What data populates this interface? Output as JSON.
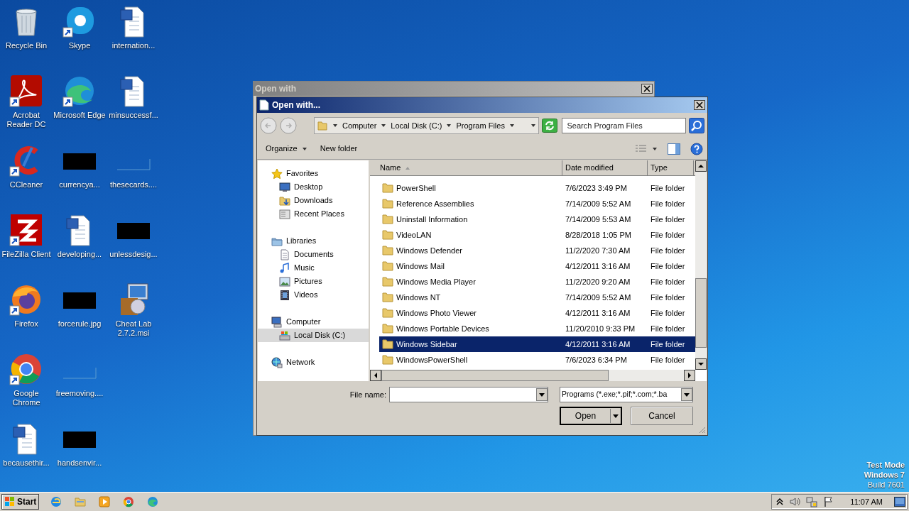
{
  "desktop": {
    "icons": [
      {
        "label": "Recycle Bin",
        "kind": "recycle",
        "shortcut": false
      },
      {
        "label": "Acrobat Reader DC",
        "kind": "acrobat",
        "shortcut": true
      },
      {
        "label": "CCleaner",
        "kind": "ccleaner",
        "shortcut": true
      },
      {
        "label": "FileZilla Client",
        "kind": "filezilla",
        "shortcut": true
      },
      {
        "label": "Firefox",
        "kind": "firefox",
        "shortcut": true
      },
      {
        "label": "Google Chrome",
        "kind": "chrome",
        "shortcut": true
      },
      {
        "label": "becausethir...",
        "kind": "word",
        "shortcut": false
      },
      {
        "label": "Skype",
        "kind": "skype",
        "shortcut": true
      },
      {
        "label": "Microsoft Edge",
        "kind": "edge",
        "shortcut": true
      },
      {
        "label": "currencya...",
        "kind": "redacted",
        "shortcut": false
      },
      {
        "label": "developing...",
        "kind": "word",
        "shortcut": false
      },
      {
        "label": "forcerule.jpg",
        "kind": "redacted",
        "shortcut": false
      },
      {
        "label": "freemoving....",
        "kind": "blank",
        "shortcut": false
      },
      {
        "label": "handsenvir...",
        "kind": "redacted",
        "shortcut": false
      },
      {
        "label": "internation...",
        "kind": "word",
        "shortcut": false
      },
      {
        "label": "minsuccessf...",
        "kind": "word",
        "shortcut": false
      },
      {
        "label": "thesecards....",
        "kind": "blank",
        "shortcut": false
      },
      {
        "label": "unlessdesig...",
        "kind": "redacted",
        "shortcut": false
      },
      {
        "label": "Cheat Lab 2.7.2.msi",
        "kind": "installer",
        "shortcut": false
      }
    ],
    "system_text": [
      {
        "text": "Test Mode",
        "kind": "heading"
      },
      {
        "text": "Windows 7",
        "kind": "heading"
      },
      {
        "text": "Build 7601",
        "kind": "detail"
      }
    ]
  },
  "background_window": {
    "title": "Open with"
  },
  "dialog": {
    "title": "Open with...",
    "breadcrumb": [
      "Computer",
      "Local Disk (C:)",
      "Program Files"
    ],
    "search": {
      "placeholder": "Search Program Files"
    },
    "toolbar": {
      "organize": "Organize",
      "new_folder": "New folder"
    },
    "navigation": [
      {
        "label": "Favorites",
        "kind": "star",
        "selected": false,
        "children": [
          {
            "label": "Desktop",
            "kind": "desktop",
            "selected": false
          },
          {
            "label": "Downloads",
            "kind": "downloads",
            "selected": false
          },
          {
            "label": "Recent Places",
            "kind": "recent",
            "selected": false
          }
        ]
      },
      {
        "label": "Libraries",
        "kind": "library",
        "selected": false,
        "children": [
          {
            "label": "Documents",
            "kind": "documents",
            "selected": false
          },
          {
            "label": "Music",
            "kind": "music",
            "selected": false
          },
          {
            "label": "Pictures",
            "kind": "pictures",
            "selected": false
          },
          {
            "label": "Videos",
            "kind": "videos",
            "selected": false
          }
        ]
      },
      {
        "label": "Computer",
        "kind": "computer",
        "selected": false,
        "children": [
          {
            "label": "Local Disk (C:)",
            "kind": "disk",
            "selected": true
          }
        ]
      },
      {
        "label": "Network",
        "kind": "network",
        "selected": false
      }
    ],
    "table": {
      "columns": [
        {
          "label": "Name",
          "sorted": true
        },
        {
          "label": "Date modified",
          "sorted": false
        },
        {
          "label": "Type",
          "sorted": false
        }
      ],
      "rows": [
        {
          "name": "PowerShell",
          "date": "7/6/2023 3:49 PM",
          "type": "File folder",
          "selected": false
        },
        {
          "name": "Reference Assemblies",
          "date": "7/14/2009 5:52 AM",
          "type": "File folder",
          "selected": false
        },
        {
          "name": "Uninstall Information",
          "date": "7/14/2009 5:53 AM",
          "type": "File folder",
          "selected": false
        },
        {
          "name": "VideoLAN",
          "date": "8/28/2018 1:05 PM",
          "type": "File folder",
          "selected": false
        },
        {
          "name": "Windows Defender",
          "date": "11/2/2020 7:30 AM",
          "type": "File folder",
          "selected": false
        },
        {
          "name": "Windows Mail",
          "date": "4/12/2011 3:16 AM",
          "type": "File folder",
          "selected": false
        },
        {
          "name": "Windows Media Player",
          "date": "11/2/2020 9:20 AM",
          "type": "File folder",
          "selected": false
        },
        {
          "name": "Windows NT",
          "date": "7/14/2009 5:52 AM",
          "type": "File folder",
          "selected": false
        },
        {
          "name": "Windows Photo Viewer",
          "date": "4/12/2011 3:16 AM",
          "type": "File folder",
          "selected": false
        },
        {
          "name": "Windows Portable Devices",
          "date": "11/20/2010 9:33 PM",
          "type": "File folder",
          "selected": false
        },
        {
          "name": "Windows Sidebar",
          "date": "4/12/2011 3:16 AM",
          "type": "File folder",
          "selected": true
        },
        {
          "name": "WindowsPowerShell",
          "date": "7/6/2023 6:34 PM",
          "type": "File folder",
          "selected": false
        }
      ]
    },
    "file_name": {
      "label": "File name:"
    },
    "file_type": {
      "value": "Programs (*.exe;*.pif;*.com;*.ba"
    },
    "buttons": [
      {
        "label": "Open",
        "kind": "split"
      },
      {
        "label": "Cancel",
        "kind": "plain"
      }
    ]
  },
  "taskbar": {
    "start": "Start",
    "clock": "11:07 AM"
  }
}
